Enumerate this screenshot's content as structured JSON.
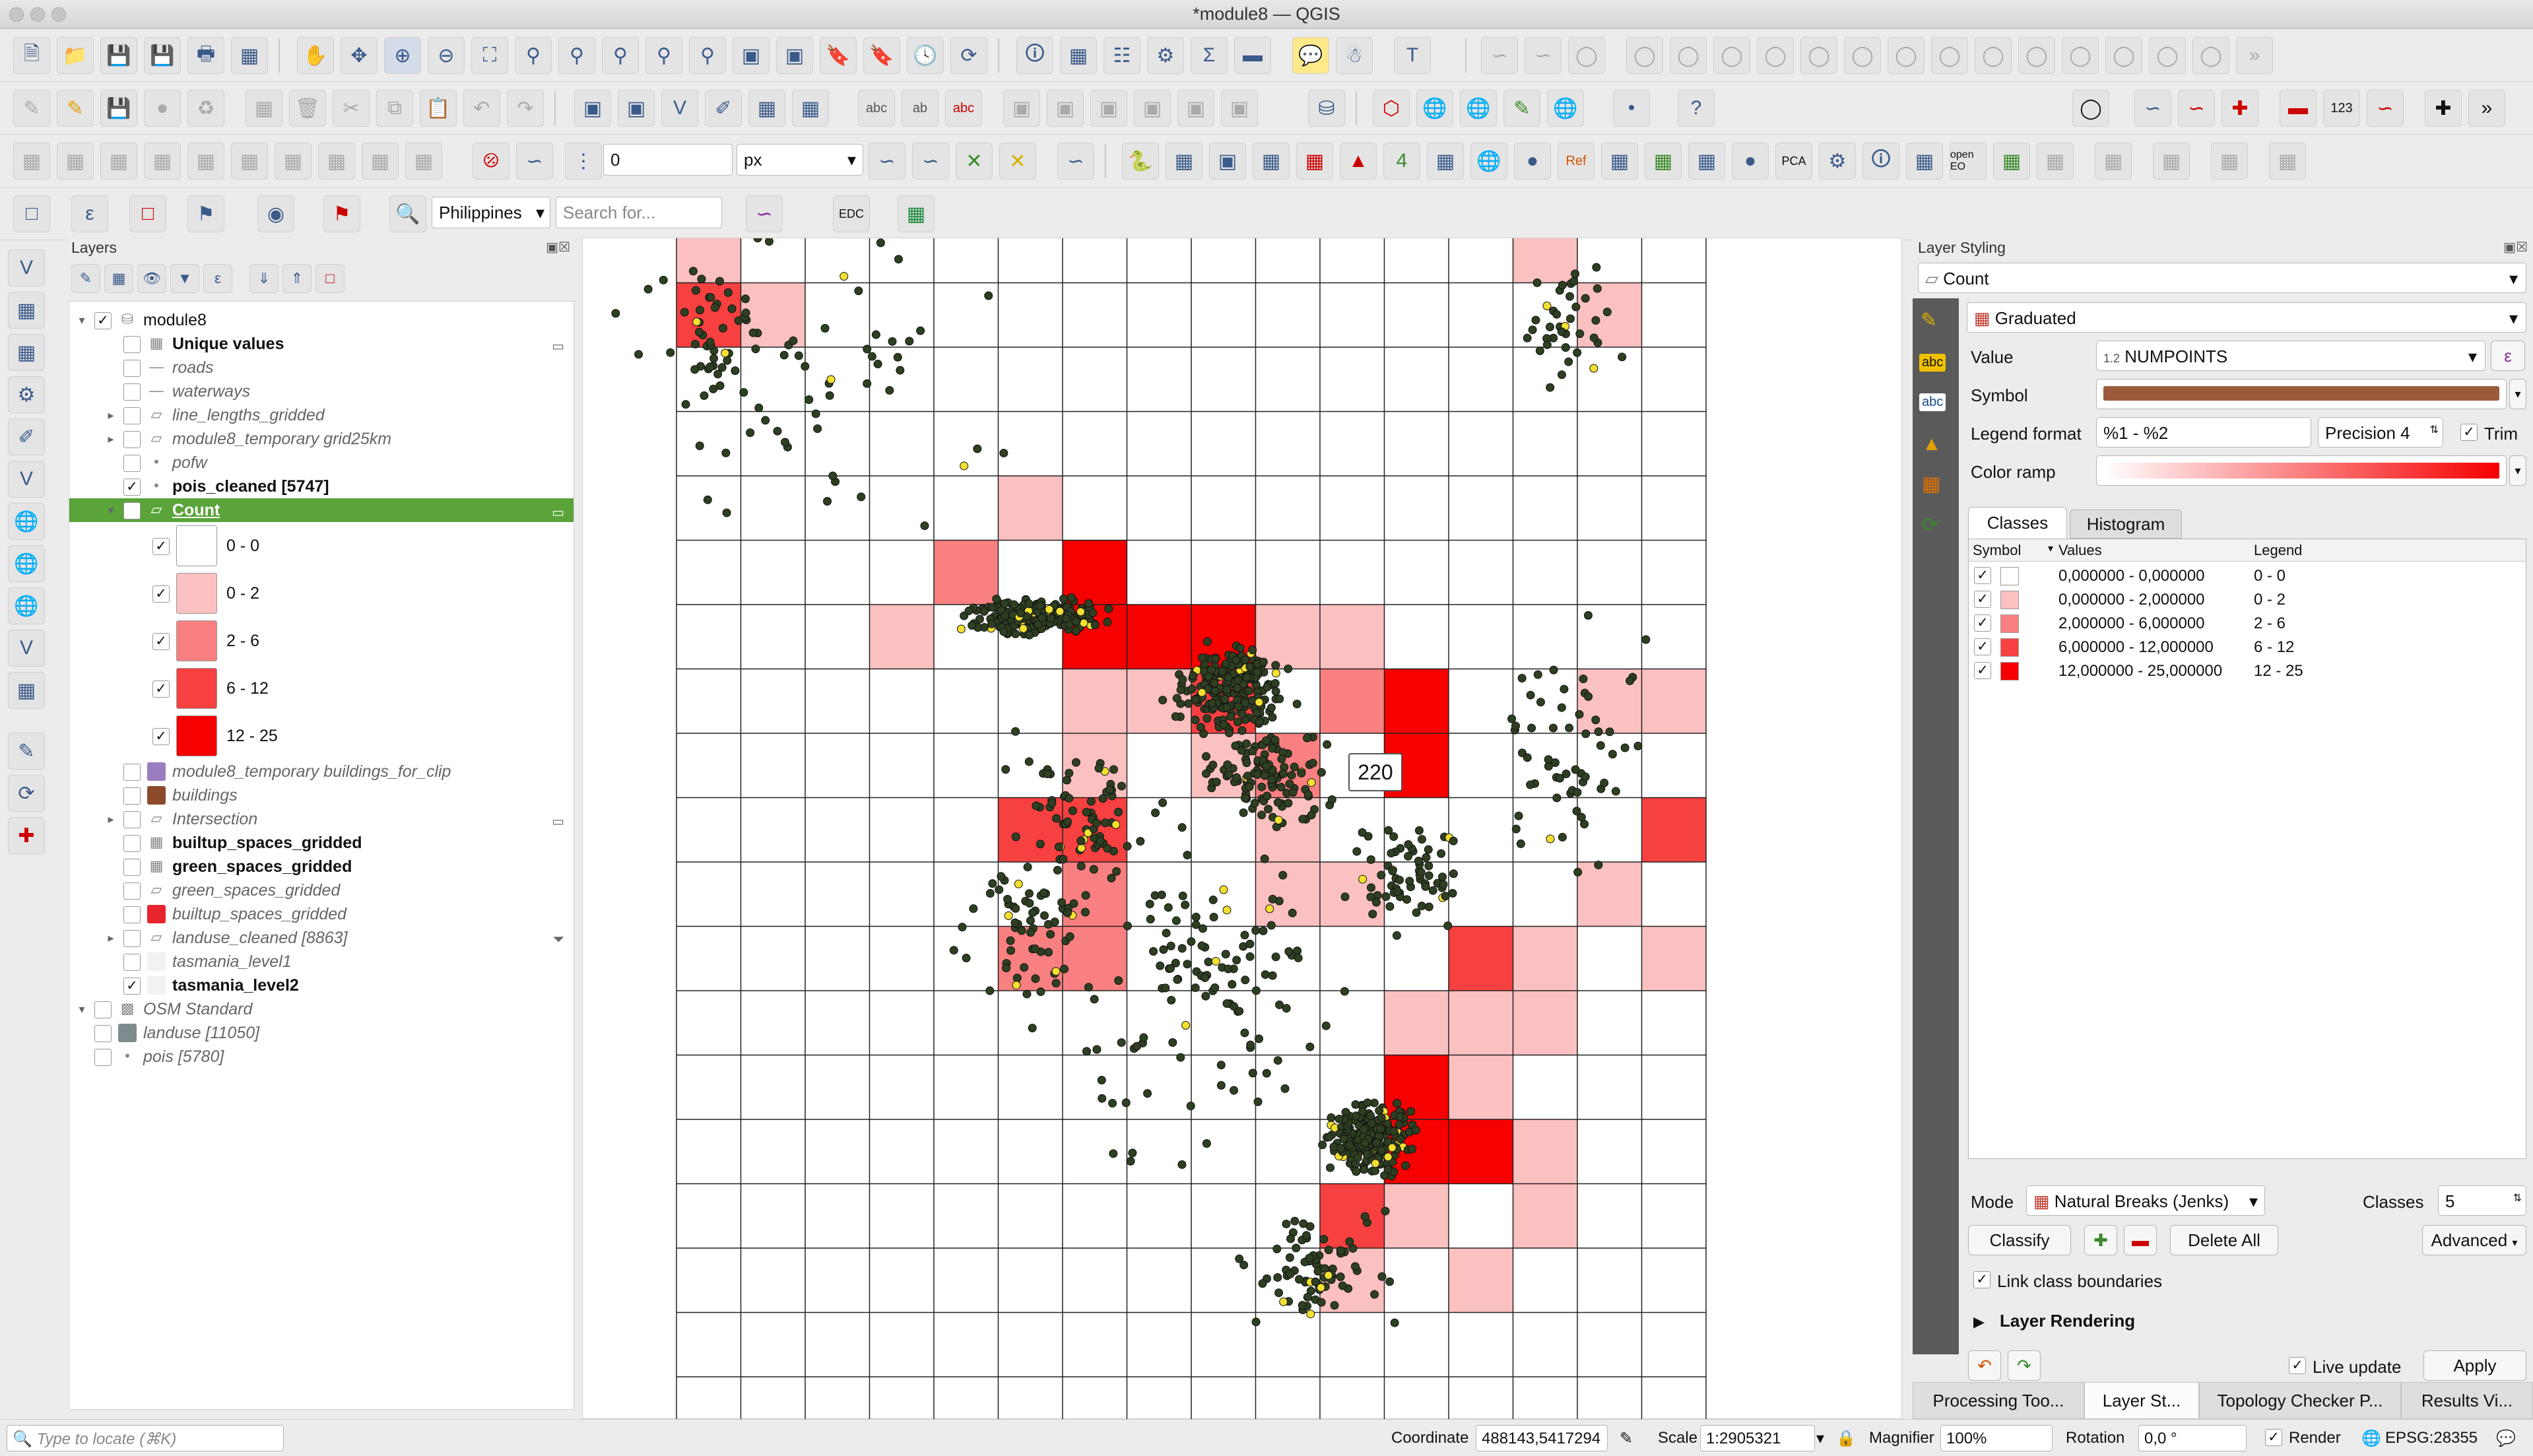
{
  "window": {
    "title": "*module8 — QGIS"
  },
  "toolbar": {
    "snapping_tolerance": "0",
    "snapping_units": "px",
    "locator_country": "Philippines",
    "search_placeholder": "Search for...",
    "edc_label": "EDC",
    "openeo_label": "open EO",
    "pca_label": "PCA",
    "ref_label": "Ref",
    "badge_123": "123"
  },
  "layers_panel": {
    "title": "Layers",
    "items": [
      {
        "label": "module8",
        "checked": true,
        "expanded": true,
        "indent": 0,
        "icon": "group",
        "style": ""
      },
      {
        "label": "Unique values",
        "checked": false,
        "indent": 1,
        "icon": "table",
        "style": "bold"
      },
      {
        "label": "roads",
        "checked": false,
        "indent": 1,
        "icon": "line",
        "style": "italic"
      },
      {
        "label": "waterways",
        "checked": false,
        "indent": 1,
        "icon": "line",
        "style": "italic"
      },
      {
        "label": "line_lengths_gridded",
        "checked": false,
        "indent": 1,
        "icon": "polygon",
        "style": "italic",
        "expandable": true
      },
      {
        "label": "module8_temporary grid25km",
        "checked": false,
        "indent": 1,
        "icon": "polygon",
        "style": "italic",
        "expandable": true
      },
      {
        "label": "pofw",
        "checked": false,
        "indent": 1,
        "icon": "point",
        "style": "italic"
      },
      {
        "label": "pois_cleaned [5747]",
        "checked": true,
        "indent": 1,
        "icon": "point",
        "style": "bold"
      },
      {
        "label": "Count",
        "checked": true,
        "indent": 1,
        "icon": "polygon",
        "style": "selected",
        "expandable": true,
        "expanded": true
      },
      {
        "label": "0 - 0",
        "checked": true,
        "indent": 2,
        "icon": "legend",
        "color": "#ffffff",
        "style": ""
      },
      {
        "label": "0 - 2",
        "checked": true,
        "indent": 2,
        "icon": "legend",
        "color": "#fbc0c0",
        "style": ""
      },
      {
        "label": "2 - 6",
        "checked": true,
        "indent": 2,
        "icon": "legend",
        "color": "#f98080",
        "style": ""
      },
      {
        "label": "6 - 12",
        "checked": true,
        "indent": 2,
        "icon": "legend",
        "color": "#f74040",
        "style": ""
      },
      {
        "label": "12 - 25",
        "checked": true,
        "indent": 2,
        "icon": "legend",
        "color": "#f60000",
        "style": ""
      },
      {
        "label": "module8_temporary buildings_for_clip",
        "checked": false,
        "indent": 1,
        "icon": "fill",
        "color": "#9a7dc0",
        "style": "italic"
      },
      {
        "label": "buildings",
        "checked": false,
        "indent": 1,
        "icon": "fill",
        "color": "#8b4a2b",
        "style": "italic"
      },
      {
        "label": "Intersection",
        "checked": false,
        "indent": 1,
        "icon": "polygon",
        "style": "italic",
        "expandable": true
      },
      {
        "label": "builtup_spaces_gridded",
        "checked": false,
        "indent": 1,
        "icon": "table",
        "style": "bold"
      },
      {
        "label": "green_spaces_gridded",
        "checked": false,
        "indent": 1,
        "icon": "table",
        "style": "bold"
      },
      {
        "label": "green_spaces_gridded",
        "checked": false,
        "indent": 1,
        "icon": "polygon",
        "style": "italic"
      },
      {
        "label": "builtup_spaces_gridded",
        "checked": false,
        "indent": 1,
        "icon": "fill",
        "color": "#e8242c",
        "style": "italic"
      },
      {
        "label": "landuse_cleaned [8863]",
        "checked": false,
        "indent": 1,
        "icon": "polygon",
        "style": "italic",
        "expandable": true
      },
      {
        "label": "tasmania_level1",
        "checked": false,
        "indent": 1,
        "icon": "fill",
        "color": "#f2f2f2",
        "style": "italic"
      },
      {
        "label": "tasmania_level2",
        "checked": true,
        "indent": 1,
        "icon": "fill",
        "color": "#f2f2f2",
        "style": "bold"
      },
      {
        "label": "OSM Standard",
        "checked": false,
        "indent": 0,
        "icon": "raster",
        "style": "italic",
        "expanded": true
      },
      {
        "label": "landuse [11050]",
        "checked": false,
        "indent": 0,
        "icon": "fill",
        "color": "#7f8c8d",
        "style": "italic"
      },
      {
        "label": "pois [5780]",
        "checked": false,
        "indent": 0,
        "icon": "point",
        "style": "italic"
      }
    ]
  },
  "map": {
    "tooltip_value": "220",
    "grid_cols": 16,
    "grid_rows": 18,
    "class_colors": [
      "#ffffff",
      "#fbc0c0",
      "#f98080",
      "#f74040",
      "#f60000"
    ],
    "cells": [
      [
        0,
        0,
        1
      ],
      [
        1,
        0,
        3
      ],
      [
        1,
        1,
        1
      ],
      [
        0,
        13,
        1
      ],
      [
        1,
        14,
        1
      ],
      [
        4,
        5,
        1
      ],
      [
        5,
        4,
        2
      ],
      [
        5,
        6,
        4
      ],
      [
        6,
        3,
        1
      ],
      [
        6,
        6,
        4
      ],
      [
        6,
        7,
        4
      ],
      [
        6,
        8,
        4
      ],
      [
        6,
        9,
        1
      ],
      [
        6,
        10,
        1
      ],
      [
        7,
        6,
        1
      ],
      [
        7,
        7,
        1
      ],
      [
        7,
        8,
        3
      ],
      [
        7,
        10,
        2
      ],
      [
        7,
        11,
        4
      ],
      [
        7,
        14,
        1
      ],
      [
        7,
        15,
        1
      ],
      [
        8,
        6,
        1
      ],
      [
        8,
        8,
        1
      ],
      [
        8,
        9,
        2
      ],
      [
        8,
        11,
        4
      ],
      [
        9,
        5,
        3
      ],
      [
        9,
        6,
        3
      ],
      [
        9,
        9,
        1
      ],
      [
        9,
        15,
        3
      ],
      [
        10,
        6,
        2
      ],
      [
        10,
        9,
        1
      ],
      [
        10,
        10,
        1
      ],
      [
        10,
        14,
        1
      ],
      [
        11,
        5,
        2
      ],
      [
        11,
        6,
        2
      ],
      [
        11,
        12,
        3
      ],
      [
        11,
        13,
        1
      ],
      [
        11,
        15,
        1
      ],
      [
        12,
        11,
        1
      ],
      [
        12,
        12,
        1
      ],
      [
        12,
        13,
        1
      ],
      [
        13,
        11,
        4
      ],
      [
        13,
        12,
        1
      ],
      [
        14,
        11,
        4
      ],
      [
        14,
        12,
        4
      ],
      [
        14,
        13,
        1
      ],
      [
        15,
        10,
        3
      ],
      [
        15,
        11,
        1
      ],
      [
        15,
        13,
        1
      ],
      [
        16,
        10,
        1
      ],
      [
        16,
        12,
        1
      ]
    ],
    "clusters": [
      [
        5.6,
        6.2,
        260,
        1.4,
        0.35
      ],
      [
        8.6,
        7.3,
        220,
        1.1,
        0.9
      ],
      [
        10.8,
        14.3,
        260,
        0.9,
        0.7
      ],
      [
        9.2,
        8.6,
        120,
        1.2,
        1.1
      ],
      [
        7.8,
        12.0,
        80,
        3.0,
        4.0
      ],
      [
        2.0,
        2.5,
        60,
        4.0,
        3.0
      ],
      [
        0.6,
        1.8,
        40,
        0.8,
        1.2
      ],
      [
        13.9,
        1.6,
        40,
        0.9,
        1.3
      ],
      [
        13.8,
        8.4,
        60,
        1.5,
        3.2
      ],
      [
        5.4,
        11.0,
        60,
        1.4,
        2.0
      ],
      [
        10.0,
        16.4,
        80,
        1.5,
        1.2
      ],
      [
        6.2,
        9.5,
        70,
        1.5,
        1.8
      ],
      [
        11.4,
        10.2,
        70,
        1.3,
        1.2
      ],
      [
        8.4,
        11.5,
        50,
        1.6,
        1.8
      ]
    ]
  },
  "layer_styling": {
    "title": "Layer Styling",
    "layer": "Count",
    "renderer": "Graduated",
    "value_label": "Value",
    "value_field": "NUMPOINTS",
    "value_type": "1.2",
    "symbol_label": "Symbol",
    "symbol_color": "#9c5a3c",
    "legend_format_label": "Legend format",
    "legend_format": "%1 - %2",
    "precision": "Precision 4",
    "trim_label": "Trim",
    "color_ramp_label": "Color ramp",
    "ramp_start": "#ffffff",
    "ramp_end": "#f60000",
    "tabs": [
      "Classes",
      "Histogram"
    ],
    "table_headers": [
      "Symbol",
      "Values",
      "Legend"
    ],
    "classes": [
      {
        "color": "#ffffff",
        "values": "0,000000 - 0,000000",
        "legend": "0 - 0"
      },
      {
        "color": "#fbc0c0",
        "values": "0,000000 - 2,000000",
        "legend": "0 - 2"
      },
      {
        "color": "#f98080",
        "values": "2,000000 - 6,000000",
        "legend": "2 - 6"
      },
      {
        "color": "#f74040",
        "values": "6,000000 - 12,000000",
        "legend": "6 - 12"
      },
      {
        "color": "#f60000",
        "values": "12,000000 - 25,000000",
        "legend": "12 - 25"
      }
    ],
    "mode_label": "Mode",
    "mode": "Natural Breaks (Jenks)",
    "classes_label": "Classes",
    "classes_count": "5",
    "classify_button": "Classify",
    "delete_all_button": "Delete All",
    "advanced_button": "Advanced",
    "link_class_boundaries": "Link class boundaries",
    "layer_rendering": "Layer Rendering",
    "live_update": "Live update",
    "apply_button": "Apply"
  },
  "bottom_tabs": [
    "Processing Too...",
    "Layer St...",
    "Topology Checker P...",
    "Results Vi..."
  ],
  "statusbar": {
    "locator_placeholder": "Type to locate (⌘K)",
    "coordinate_label": "Coordinate",
    "coordinate": "488143,5417294",
    "scale_label": "Scale",
    "scale": "1:2905321",
    "magnifier_label": "Magnifier",
    "magnifier": "100%",
    "rotation_label": "Rotation",
    "rotation": "0,0 °",
    "render_label": "Render",
    "crs": "EPSG:28355"
  }
}
